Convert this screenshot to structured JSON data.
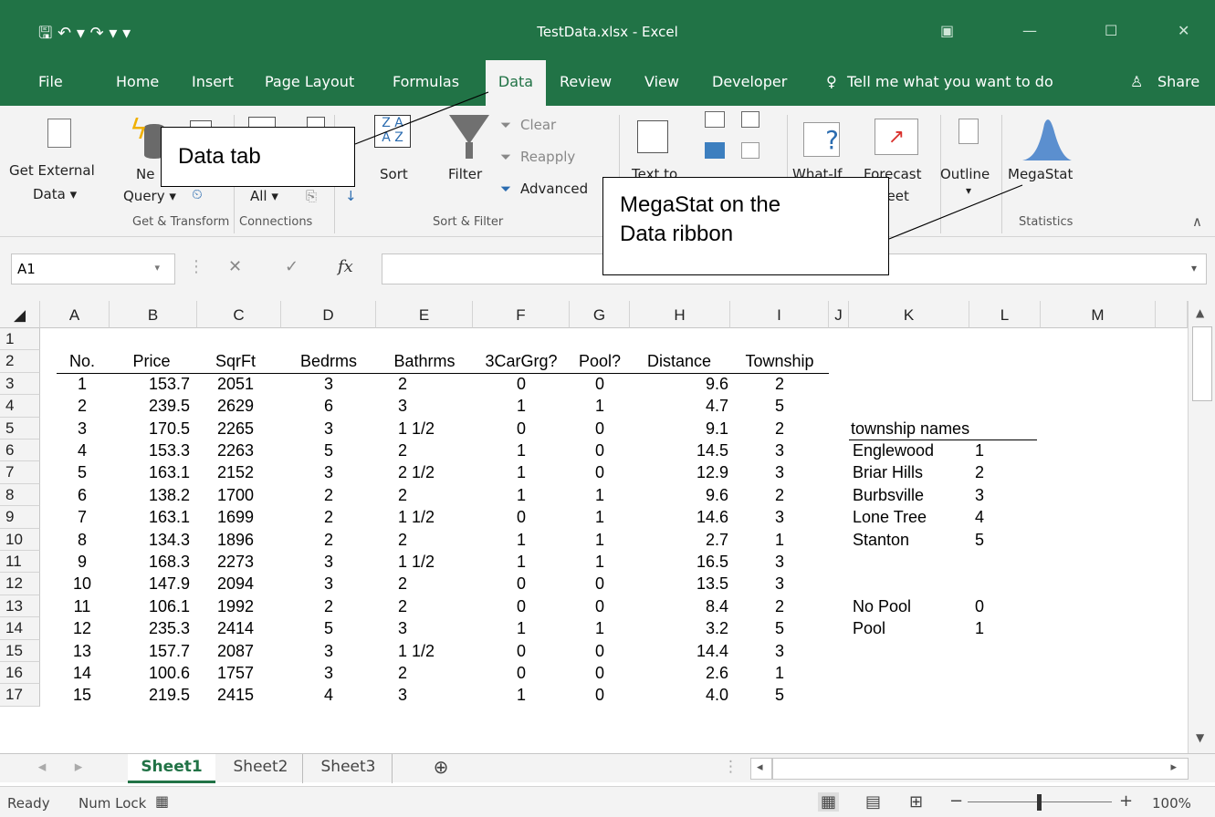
{
  "window": {
    "title": "TestData.xlsx - Excel",
    "qat": "🖫  ↶ ▾  ↷ ▾  ▾"
  },
  "tabs": [
    {
      "label": "File"
    },
    {
      "label": "Home"
    },
    {
      "label": "Insert"
    },
    {
      "label": "Page Layout"
    },
    {
      "label": "Formulas"
    },
    {
      "label": "Data"
    },
    {
      "label": "Review"
    },
    {
      "label": "View"
    },
    {
      "label": "Developer"
    },
    {
      "label": "Tell me what you want to do"
    },
    {
      "label": "Share"
    }
  ],
  "ribbon": {
    "get_external": "Get External",
    "data_menu": "Data ▾",
    "new": "Ne",
    "query": "Query ▾",
    "all": "All ▾",
    "sort": "Sort",
    "filter": "Filter",
    "clear": "Clear",
    "reapply": "Reapply",
    "advanced": "Advanced",
    "text_to": "Text to",
    "whatif": "What-If",
    "forecast": "Forecast",
    "heet": "heet",
    "outline": "Outline",
    "outline_arrow": "▾",
    "megastat": "MegaStat",
    "groups": [
      "Get & Transform",
      "Connections",
      "Sort & Filter",
      "Statistics"
    ]
  },
  "callouts": {
    "data_tab": "Data tab",
    "megastat_line1": "MegaStat on the",
    "megastat_line2": "Data ribbon"
  },
  "formula_bar": {
    "name_box": "A1",
    "fx": "fx"
  },
  "columns": [
    "A",
    "B",
    "C",
    "D",
    "E",
    "F",
    "G",
    "H",
    "I",
    "J",
    "K",
    "L",
    "M"
  ],
  "rows": [
    "1",
    "2",
    "3",
    "4",
    "5",
    "6",
    "7",
    "8",
    "9",
    "10",
    "11",
    "12",
    "13",
    "14",
    "15",
    "16",
    "17"
  ],
  "headers": [
    "No.",
    "Price",
    "SqrFt",
    "Bedrms",
    "Bathrms",
    "3CarGrg?",
    "Pool?",
    "Distance",
    "Township"
  ],
  "data": [
    [
      "1",
      "153.7",
      "2051",
      "3",
      "2",
      "0",
      "0",
      "9.6",
      "2"
    ],
    [
      "2",
      "239.5",
      "2629",
      "6",
      "3",
      "1",
      "1",
      "4.7",
      "5"
    ],
    [
      "3",
      "170.5",
      "2265",
      "3",
      "1 1/2",
      "0",
      "0",
      "9.1",
      "2"
    ],
    [
      "4",
      "153.3",
      "2263",
      "5",
      "2",
      "1",
      "0",
      "14.5",
      "3"
    ],
    [
      "5",
      "163.1",
      "2152",
      "3",
      "2 1/2",
      "1",
      "0",
      "12.9",
      "3"
    ],
    [
      "6",
      "138.2",
      "1700",
      "2",
      "2",
      "1",
      "1",
      "9.6",
      "2"
    ],
    [
      "7",
      "163.1",
      "1699",
      "2",
      "1 1/2",
      "0",
      "1",
      "14.6",
      "3"
    ],
    [
      "8",
      "134.3",
      "1896",
      "2",
      "2",
      "1",
      "1",
      "2.7",
      "1"
    ],
    [
      "9",
      "168.3",
      "2273",
      "3",
      "1 1/2",
      "1",
      "1",
      "16.5",
      "3"
    ],
    [
      "10",
      "147.9",
      "2094",
      "3",
      "2",
      "0",
      "0",
      "13.5",
      "3"
    ],
    [
      "11",
      "106.1",
      "1992",
      "2",
      "2",
      "0",
      "0",
      "8.4",
      "2"
    ],
    [
      "12",
      "235.3",
      "2414",
      "5",
      "3",
      "1",
      "1",
      "3.2",
      "5"
    ],
    [
      "13",
      "157.7",
      "2087",
      "3",
      "1 1/2",
      "0",
      "0",
      "14.4",
      "3"
    ],
    [
      "14",
      "100.6",
      "1757",
      "3",
      "2",
      "0",
      "0",
      "2.6",
      "1"
    ],
    [
      "15",
      "219.5",
      "2415",
      "4",
      "3",
      "1",
      "0",
      "4.0",
      "5"
    ]
  ],
  "legend": {
    "title": "township names",
    "items": [
      [
        "Englewood",
        "1"
      ],
      [
        "Briar Hills",
        "2"
      ],
      [
        "Burbsville",
        "3"
      ],
      [
        "Lone Tree",
        "4"
      ],
      [
        "Stanton",
        "5"
      ]
    ],
    "pool": [
      [
        "No Pool",
        "0"
      ],
      [
        "Pool",
        "1"
      ]
    ]
  },
  "sheets": [
    "Sheet1",
    "Sheet2",
    "Sheet3"
  ],
  "status": {
    "ready": "Ready",
    "numlock": "Num Lock",
    "zoom": "100%"
  }
}
